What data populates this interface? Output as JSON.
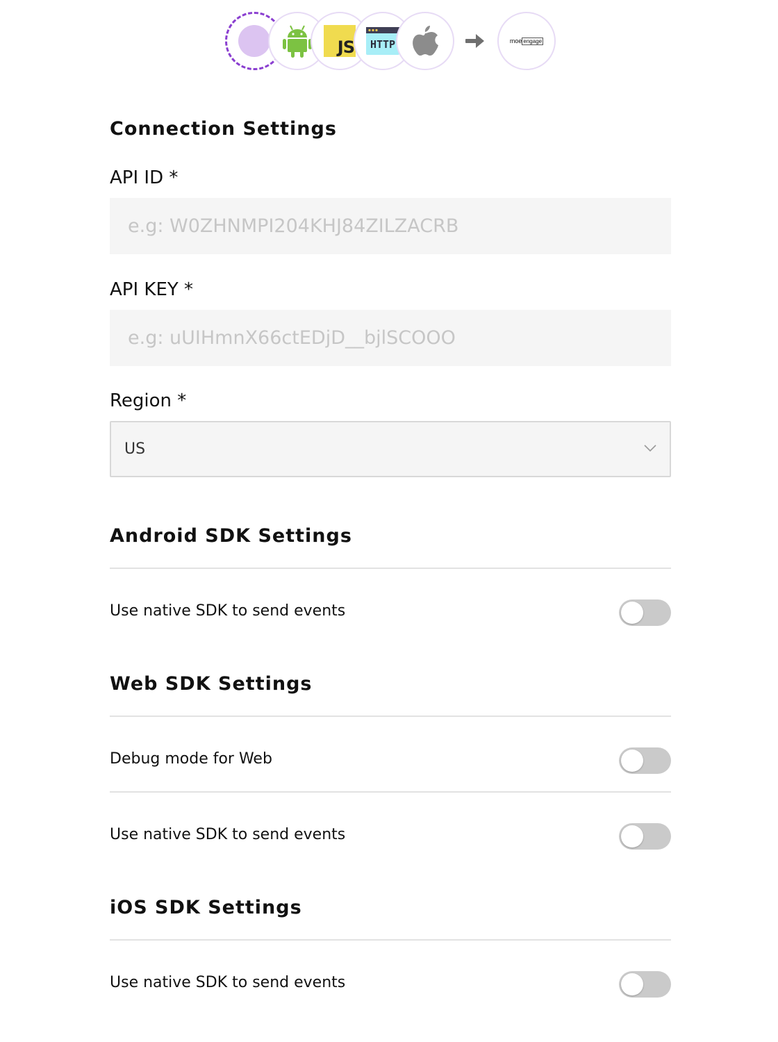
{
  "flow": {
    "sources": [
      {
        "icon": "source-placeholder-icon"
      },
      {
        "icon": "android-icon"
      },
      {
        "icon": "javascript-icon",
        "text": "JS"
      },
      {
        "icon": "http-icon",
        "text": "HTTP"
      },
      {
        "icon": "apple-icon"
      }
    ],
    "arrow_icon": "arrow-right-icon",
    "destination": {
      "icon": "moengage-logo",
      "text_plain": "moe",
      "text_boxed": "engage"
    }
  },
  "connection": {
    "title": "Connection Settings",
    "api_id": {
      "label": "API ID *",
      "value": "",
      "placeholder": "e.g: W0ZHNMPI204KHJ84ZILZACRB"
    },
    "api_key": {
      "label": "API KEY *",
      "value": "",
      "placeholder": "e.g: uUIHmnX66ctEDjD__bjlSCOOO"
    },
    "region": {
      "label": "Region *",
      "selected": "US"
    }
  },
  "android": {
    "title": "Android SDK Settings",
    "native_sdk": {
      "label": "Use native SDK to send events",
      "enabled": false
    }
  },
  "web": {
    "title": "Web SDK Settings",
    "debug_mode": {
      "label": "Debug mode for Web",
      "enabled": false
    },
    "native_sdk": {
      "label": "Use native SDK to send events",
      "enabled": false
    }
  },
  "ios": {
    "title": "iOS SDK Settings",
    "native_sdk": {
      "label": "Use native SDK to send events",
      "enabled": false
    }
  },
  "colors": {
    "accent": "#8a3ed0",
    "circle_border": "#e7dbf5",
    "android_green": "#7cc242",
    "js_yellow": "#f0db4f",
    "toggle_off": "#cacaca",
    "input_bg": "#f5f5f5"
  }
}
